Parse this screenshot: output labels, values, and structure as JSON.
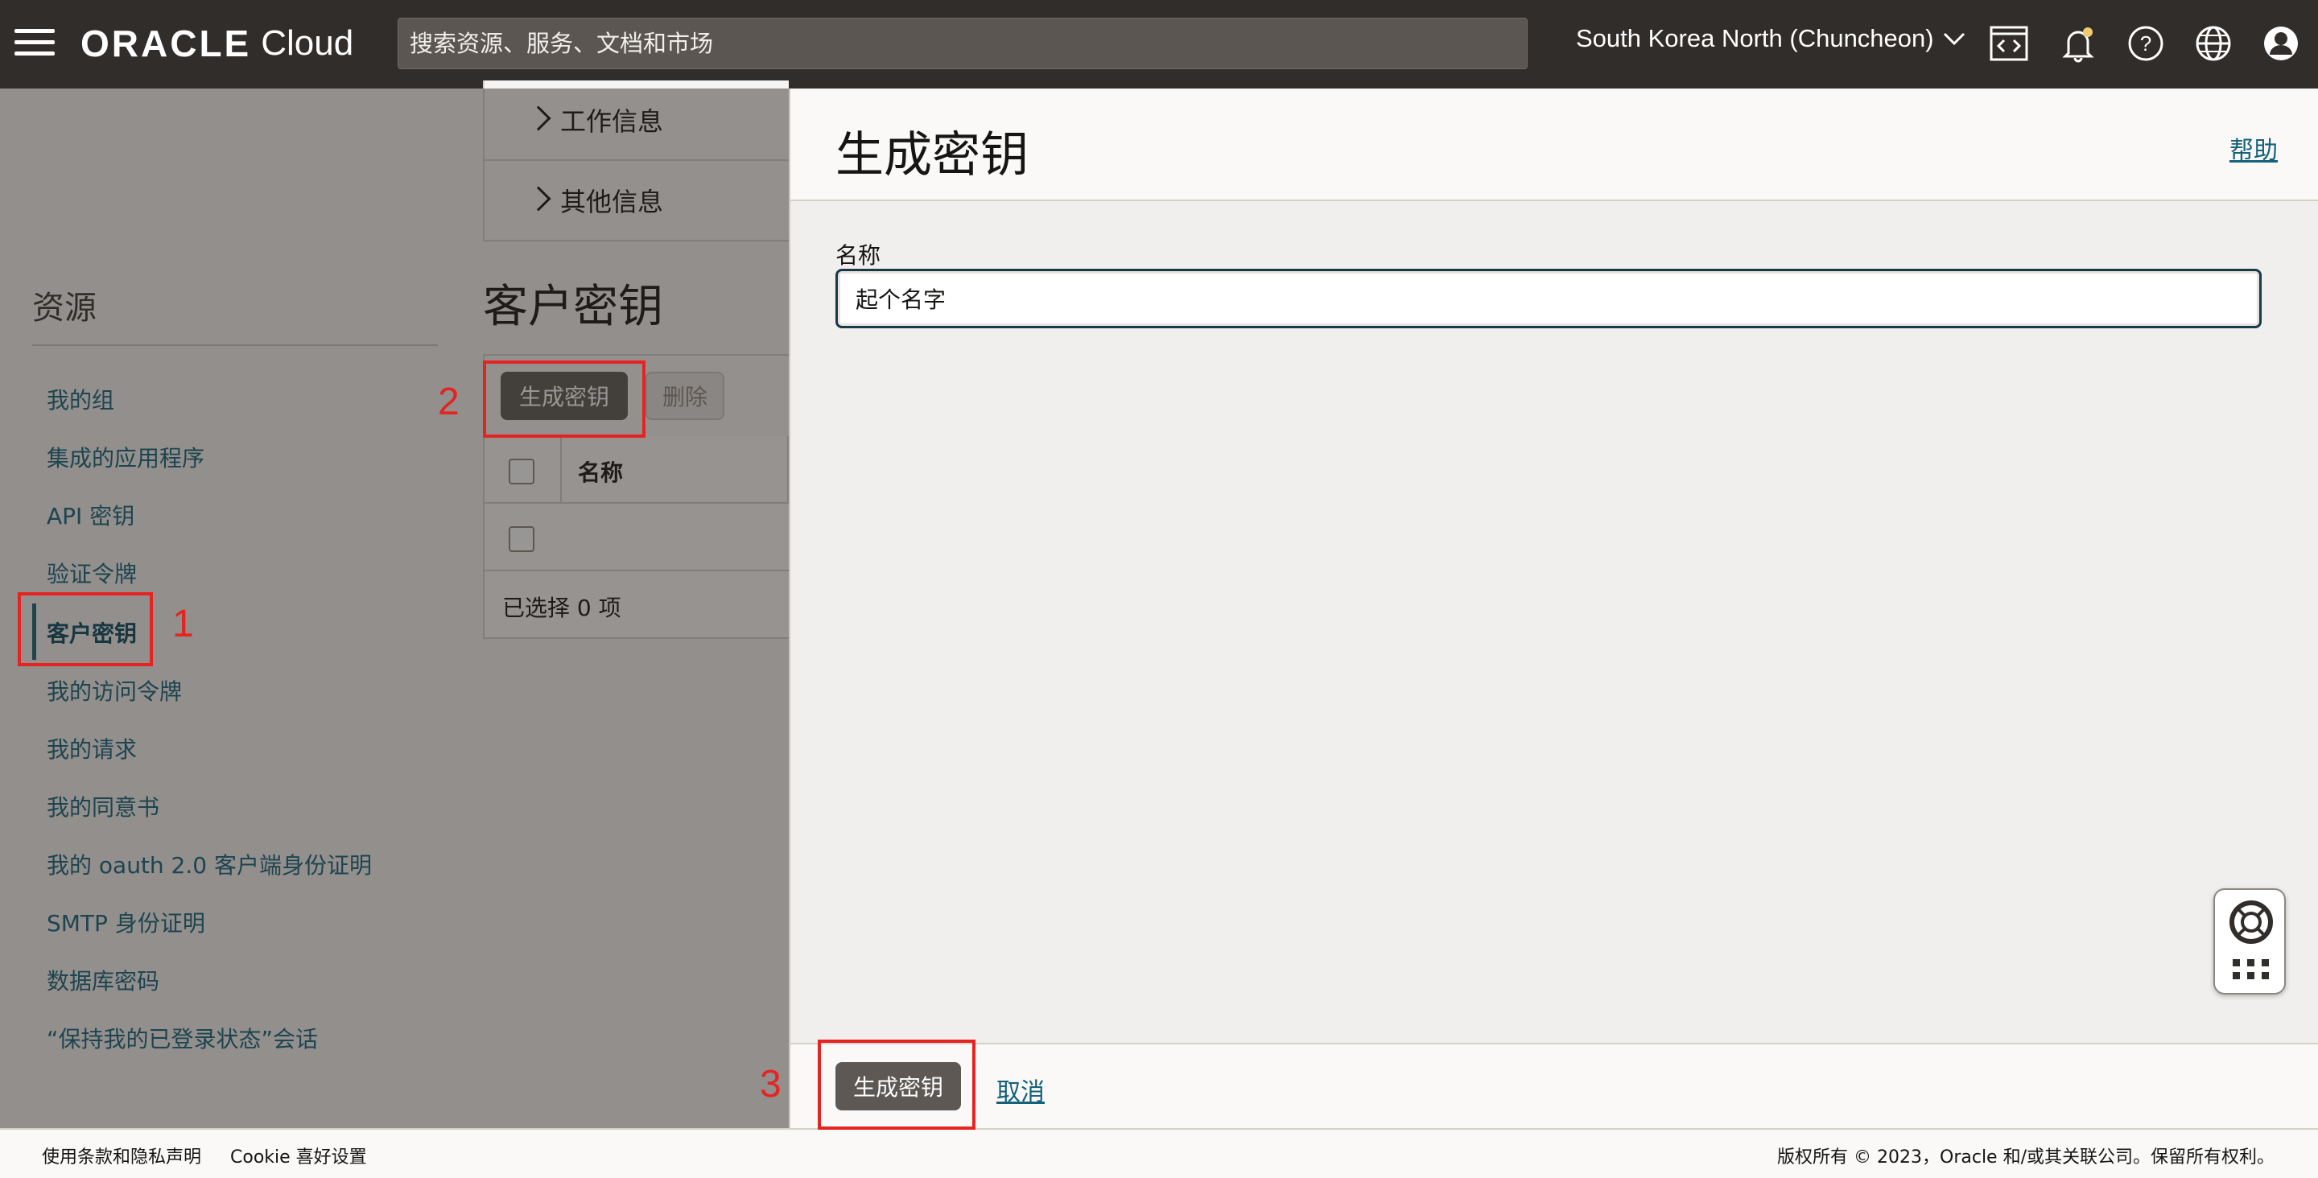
{
  "topbar": {
    "brand": "ORACLE",
    "product": "Cloud",
    "search_placeholder": "搜索资源、服务、文档和市场",
    "region": "South Korea North (Chuncheon)"
  },
  "background": {
    "accordions": [
      "工作信息",
      "其他信息"
    ],
    "resources_title": "资源",
    "resources": [
      "我的组",
      "集成的应用程序",
      "API 密钥",
      "验证令牌",
      "客户密钥",
      "我的访问令牌",
      "我的请求",
      "我的同意书",
      "我的 oauth 2.0 客户端身份证明",
      "SMTP 身份证明",
      "数据库密码",
      "“保持我的已登录状态”会话"
    ],
    "active_resource": "客户密钥",
    "section_title": "客户密钥",
    "generate_label": "生成密钥",
    "delete_label": "删除",
    "table_header": "名称",
    "selected_text": "已选择 0 项"
  },
  "panel": {
    "title": "生成密钥",
    "help": "帮助",
    "name_label": "名称",
    "name_value": "起个名字",
    "submit_label": "生成密钥",
    "cancel_label": "取消"
  },
  "footer": {
    "terms": "使用条款和隐私声明",
    "cookie": "Cookie 喜好设置",
    "copyright": "版权所有 © 2023，Oracle 和/或其关联公司。保留所有权利。"
  },
  "annotations": [
    "1",
    "2",
    "3"
  ],
  "colors": {
    "topbar": "#312d2a",
    "link": "#14627a",
    "button": "#5d5853",
    "annotation": "#e52421"
  }
}
